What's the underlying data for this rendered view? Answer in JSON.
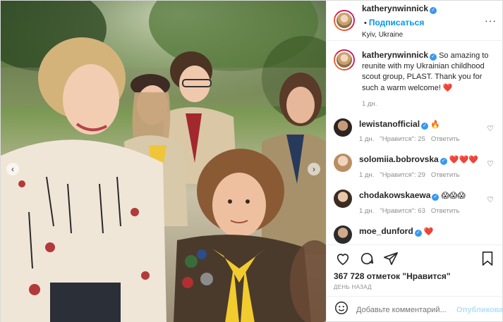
{
  "post": {
    "username": "katherynwinnick",
    "follow_label": "Подписаться",
    "location": "Kyiv, Ukraine",
    "caption": {
      "username": "katherynwinnick",
      "text": "So amazing to reunite with my Ukrainian childhood scout group, PLAST. Thank you for such a warm welcome! ❤️",
      "time": "1 дн."
    },
    "comments": [
      {
        "username": "lewistanofficial",
        "text": "🔥",
        "time": "1 дн.",
        "likes": "\"Нравится\": 25",
        "reply": "Ответить"
      },
      {
        "username": "solomiia.bobrovska",
        "text": "❤️❤️❤️",
        "time": "1 дн.",
        "likes": "\"Нравится\": 29",
        "reply": "Ответить"
      },
      {
        "username": "chodakowskaewa",
        "text": "😱😱😱",
        "time": "1 дн.",
        "likes": "\"Нравится\": 63",
        "reply": "Ответить"
      },
      {
        "username": "moe_dunford",
        "text": "❤️",
        "time": "",
        "likes": "",
        "reply": ""
      }
    ],
    "likes_text": "367 728 отметок \"Нравится\"",
    "time_ago": "ДЕНЬ НАЗАД",
    "comment_placeholder": "Добавьте комментарий...",
    "publish_label": "Опубликовать"
  },
  "icons": {
    "like": "heart-icon",
    "comment": "comment-icon",
    "share": "paper-plane-icon",
    "save": "bookmark-icon",
    "emoji": "smiley-icon",
    "more": "more-dots-icon"
  },
  "colors": {
    "link_blue": "#0095f6",
    "verified_blue": "#3897f0",
    "muted_text": "#8e8e8e",
    "disabled_publish": "#b2dffc"
  }
}
